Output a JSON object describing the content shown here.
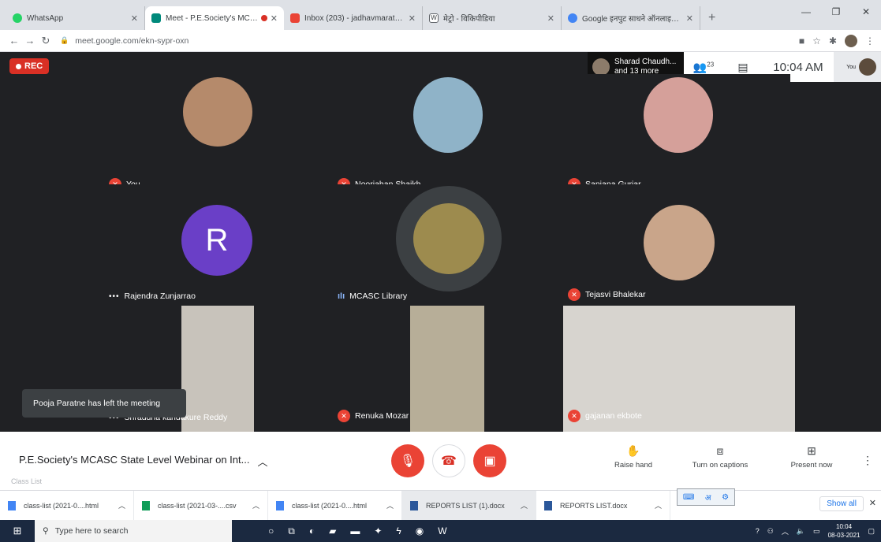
{
  "browser": {
    "tabs": [
      {
        "title": "WhatsApp",
        "color": "#25d366",
        "active": false
      },
      {
        "title": "Meet - P.E.Society's MCASC",
        "color": "#00897b",
        "active": true
      },
      {
        "title": "Inbox (203) - jadhavmarathi@m",
        "color": "#ea4335",
        "active": false
      },
      {
        "title": "मेट्रो - विकिपीडिया",
        "color": "#5f6368",
        "active": false
      },
      {
        "title": "Google इनपुट साधने ऑनलाइन वापर",
        "color": "#4285f4",
        "active": false
      }
    ],
    "new_tab": "+",
    "url": "meet.google.com/ekn-sypr-oxn"
  },
  "meet": {
    "rec_label": "REC",
    "presenter": {
      "name": "Sharad Chaudh...",
      "sub": "and 13 more"
    },
    "people_count": "23",
    "clock": "10:04 AM",
    "self_label": "You",
    "participants": [
      {
        "name": "You",
        "status": "muted"
      },
      {
        "name": "Noorjahan Shaikh",
        "status": "muted"
      },
      {
        "name": "Sanjana Gurjar",
        "status": "muted"
      },
      {
        "name": "Rajendra Zunjarrao",
        "status": "dots",
        "initial": "R"
      },
      {
        "name": "MCASC Library",
        "status": "talking"
      },
      {
        "name": "Tejasvi Bhalekar",
        "status": "muted"
      },
      {
        "name": "Shraddha kandakure Reddy",
        "status": "dots"
      },
      {
        "name": "Renuka Mozar",
        "status": "muted"
      },
      {
        "name": "gajanan ekbote",
        "status": "muted"
      }
    ],
    "toast": "Pooja Paratne has left the meeting"
  },
  "bottombar": {
    "meeting_title": "P.E.Society's MCASC State Level Webinar on Int...",
    "raise_hand": "Raise hand",
    "captions": "Turn on captions",
    "present": "Present now",
    "ghost": "Class List"
  },
  "downloads": [
    {
      "name": "class-list (2021-0....html"
    },
    {
      "name": "class-list (2021-03-....csv"
    },
    {
      "name": "class-list (2021-0....html"
    },
    {
      "name": "REPORTS LIST (1).docx"
    },
    {
      "name": "REPORTS LIST.docx"
    }
  ],
  "show_all": "Show all",
  "taskbar": {
    "search_placeholder": "Type here to search",
    "time": "10:04",
    "date": "08-03-2021"
  }
}
